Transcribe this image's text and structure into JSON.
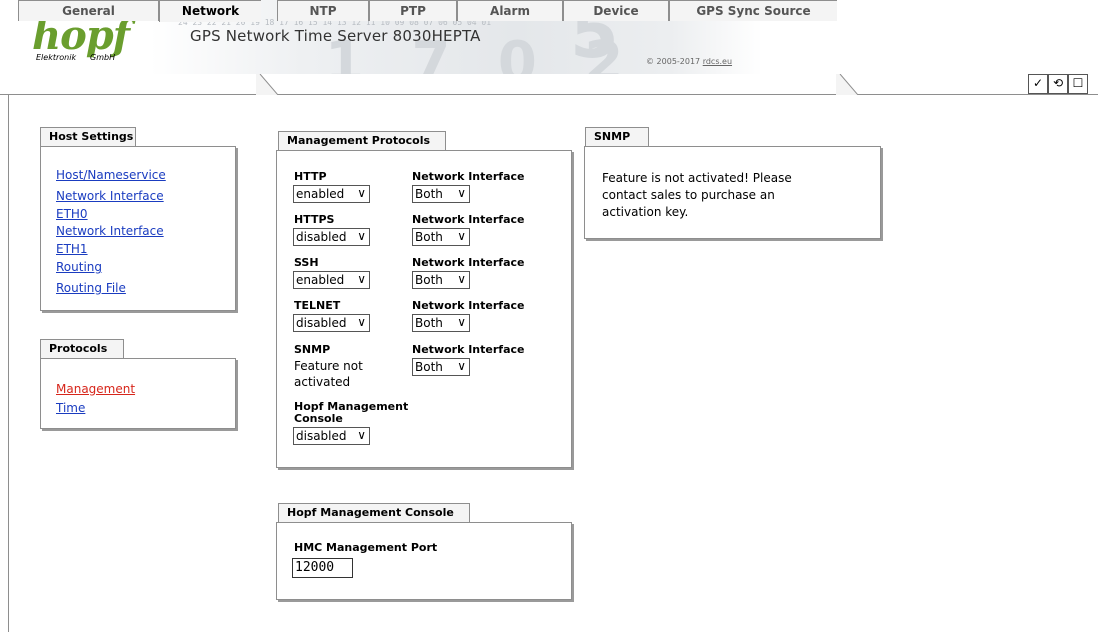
{
  "header": {
    "logo": "hopf",
    "logo_sub": "Elektronik",
    "logo_gmbh": "GmbH",
    "clock_digits": "24 23 22 21 20 19 18 17 16 15 14 13 12 11 10 09 08 07 06 05 04 01",
    "product_title": "GPS Network Time Server 8030HEPTA",
    "copyright_prefix": "© 2005-2017 ",
    "copyright_link": "rdcs.eu"
  },
  "tabs": [
    {
      "label": "General"
    },
    {
      "label": "Network"
    },
    {
      "label": "NTP"
    },
    {
      "label": "PTP"
    },
    {
      "label": "Alarm"
    },
    {
      "label": "Device"
    },
    {
      "label": "GPS Sync Source"
    }
  ],
  "toolbar_icons": {
    "apply": "✓",
    "reload": "⟲",
    "save": "☐"
  },
  "host_settings": {
    "title": "Host Settings",
    "links": [
      "Host/Nameservice",
      "Network Interface ETH0",
      "Network Interface ETH1",
      "Routing",
      "Routing File"
    ]
  },
  "protocols": {
    "title": "Protocols",
    "links": [
      "Management",
      "Time"
    ]
  },
  "management_protocols": {
    "title": "Management Protocols",
    "rows": [
      {
        "name": "HTTP",
        "value": "enabled",
        "iface_label": "Network Interface",
        "iface": "Both"
      },
      {
        "name": "HTTPS",
        "value": "disabled",
        "iface_label": "Network Interface",
        "iface": "Both"
      },
      {
        "name": "SSH",
        "value": "enabled",
        "iface_label": "Network Interface",
        "iface": "Both"
      },
      {
        "name": "TELNET",
        "value": "disabled",
        "iface_label": "Network Interface",
        "iface": "Both"
      },
      {
        "name": "SNMP",
        "static_line1": "Feature not",
        "static_line2": "activated",
        "iface_label": "Network Interface",
        "iface": "Both"
      }
    ],
    "hmc_label_line1": "Hopf Management",
    "hmc_label_line2": "Console",
    "hmc_value": "disabled"
  },
  "snmp": {
    "title": "SNMP",
    "message_line1": "Feature is not activated! Please",
    "message_line2": "contact sales to purchase an",
    "message_line3": "activation key."
  },
  "hmc": {
    "title": "Hopf Management Console",
    "port_label": "HMC Management Port",
    "port_value": "12000"
  }
}
